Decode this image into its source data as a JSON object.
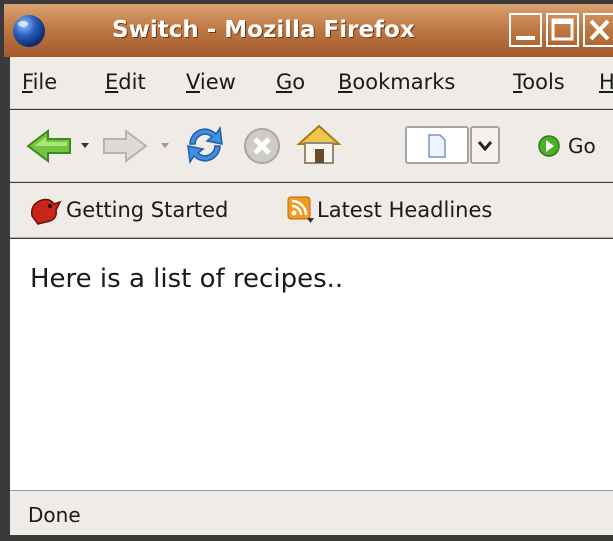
{
  "window": {
    "title": "Switch - Mozilla Firefox"
  },
  "menubar": {
    "items": [
      {
        "mnemonic": "F",
        "rest": "ile"
      },
      {
        "mnemonic": "E",
        "rest": "dit"
      },
      {
        "mnemonic": "V",
        "rest": "iew"
      },
      {
        "mnemonic": "G",
        "rest": "o"
      },
      {
        "mnemonic": "B",
        "rest": "ookmarks"
      },
      {
        "mnemonic": "T",
        "rest": "ools"
      },
      {
        "mnemonic": "H",
        "rest": ""
      }
    ]
  },
  "navbar": {
    "go_label": "Go",
    "icons": [
      "back-arrow-icon",
      "forward-arrow-icon",
      "reload-icon",
      "stop-icon",
      "home-icon",
      "page-icon",
      "dropdown-arrow-icon",
      "go-icon"
    ]
  },
  "bookmarks": {
    "items": [
      {
        "label": "Getting Started",
        "icon": "firefox-bookmark-icon"
      },
      {
        "label": "Latest Headlines",
        "icon": "rss-feed-icon"
      }
    ]
  },
  "content": {
    "text": "Here is a list of recipes.."
  },
  "status": {
    "text": "Done"
  },
  "colors": {
    "titlebar": "#c07a45",
    "chrome": "#efebe7",
    "accent_green": "#4caf2a",
    "accent_blue": "#2f7bd8"
  }
}
